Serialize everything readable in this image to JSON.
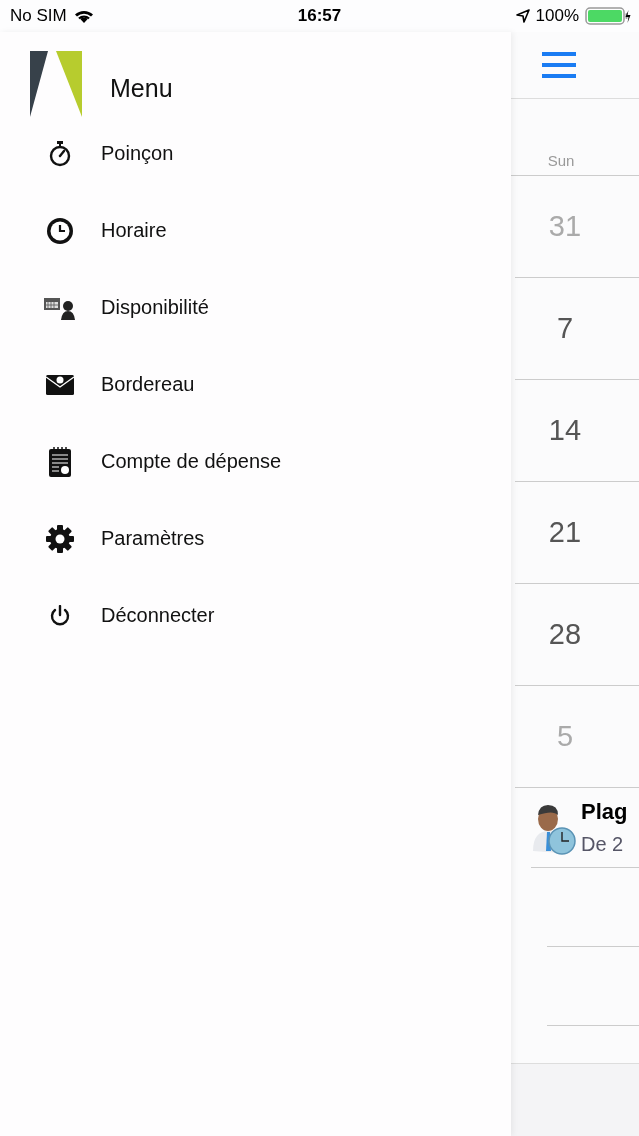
{
  "status_bar": {
    "carrier": "No SIM",
    "time": "16:57",
    "battery": "100%"
  },
  "menu": {
    "title": "Menu",
    "items": [
      {
        "kind": "stopwatch",
        "label": "Poinçon"
      },
      {
        "kind": "clock",
        "label": "Horaire"
      },
      {
        "kind": "availability",
        "label": "Disponibilité"
      },
      {
        "kind": "envelope",
        "label": "Bordereau"
      },
      {
        "kind": "expense",
        "label": "Compte de dépense"
      },
      {
        "kind": "settings",
        "label": "Paramètres"
      },
      {
        "kind": "power",
        "label": "Déconnecter"
      }
    ]
  },
  "calendar": {
    "weekday": "Sun",
    "days": [
      {
        "label": "31",
        "muted": true
      },
      {
        "label": "7",
        "muted": false
      },
      {
        "label": "14",
        "muted": false
      },
      {
        "label": "21",
        "muted": false
      },
      {
        "label": "28",
        "muted": false
      },
      {
        "label": "5",
        "muted": true
      }
    ],
    "events": [
      {
        "title": "Plag",
        "subtitle": "De 2"
      }
    ]
  }
}
